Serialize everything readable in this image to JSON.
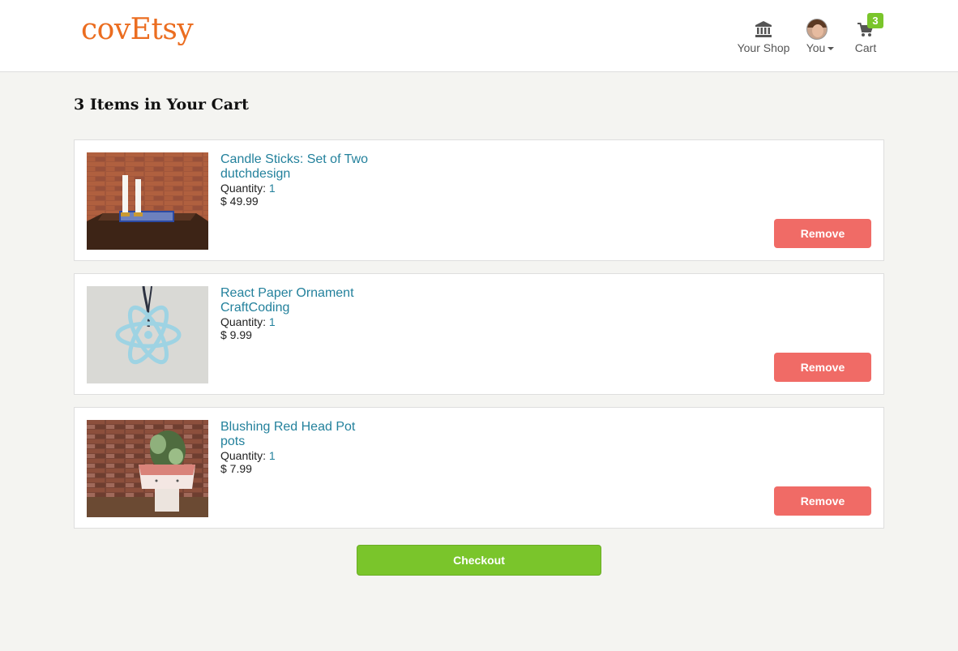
{
  "header": {
    "logo": "covEtsy",
    "nav": {
      "shop_label": "Your Shop",
      "you_label": "You",
      "cart_label": "Cart",
      "cart_count": "3"
    }
  },
  "cart": {
    "title": "3 Items in Your Cart",
    "items": [
      {
        "name": "Candle Sticks: Set of Two",
        "shop": "dutchdesign",
        "quantity_label": "Quantity: ",
        "quantity": "1",
        "price": "$ 49.99",
        "remove_label": "Remove"
      },
      {
        "name": "React Paper Ornament",
        "shop": "CraftCoding",
        "quantity_label": "Quantity: ",
        "quantity": "1",
        "price": "$ 9.99",
        "remove_label": "Remove"
      },
      {
        "name": "Blushing Red Head Pot",
        "shop": "pots",
        "quantity_label": "Quantity: ",
        "quantity": "1",
        "price": "$ 7.99",
        "remove_label": "Remove"
      }
    ],
    "checkout_label": "Checkout"
  },
  "colors": {
    "brand": "#eb6d20",
    "link": "#23819c",
    "remove": "#f06b66",
    "checkout": "#7ac52b"
  },
  "icons": [
    "bank-icon",
    "avatar",
    "chevron-down-icon",
    "cart-icon"
  ]
}
